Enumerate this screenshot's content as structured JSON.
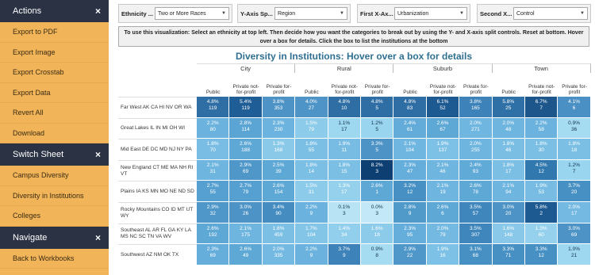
{
  "sidebar": {
    "sections": [
      {
        "title": "Actions",
        "close": "×",
        "items": [
          "Export to PDF",
          "Export Image",
          "Export Crosstab",
          "Export Data",
          "Revert All",
          "Download"
        ]
      },
      {
        "title": "Switch Sheet",
        "close": "×",
        "items": [
          "Campus Diversity",
          "Diversity in Institutions",
          "Colleges"
        ]
      },
      {
        "title": "Navigate",
        "close": "×",
        "items": [
          "Back to Workbooks"
        ]
      }
    ]
  },
  "toolbar": {
    "ethnicity": {
      "label": "Ethnicity ...",
      "value": "Two or More Races"
    },
    "yaxis": {
      "label": "Y-Axis Sp...",
      "value": "Region"
    },
    "xaxis1": {
      "label": "First X-Ax...",
      "value": "Urbanization"
    },
    "xaxis2": {
      "label": "Second X...",
      "value": "Control"
    }
  },
  "instructions": "To use this visualization: Select an ethnicity at top left.  Then decide how you want the categories to break out by using the Y- and X-axis split controls.  Reset at bottom. Hover over a box for details.  Click the box to list the institutions at the bottom",
  "title": "Diversity in Institutions: Hover over a box for details",
  "groups": [
    "City",
    "Rural",
    "Suburb",
    "Town"
  ],
  "columns": [
    "Public",
    "Private not-for-profit",
    "Private for-profit"
  ],
  "rows": [
    {
      "region": "Far West AK CA HI NV OR WA",
      "cells": [
        [
          "4.8%",
          "119"
        ],
        [
          "5.4%",
          "119"
        ],
        [
          "3.8%",
          "353"
        ],
        [
          "4.0%",
          "27"
        ],
        [
          "4.8%",
          "10"
        ],
        [
          "4.8%",
          "5"
        ],
        [
          "4.8%",
          "83"
        ],
        [
          "6.1%",
          "52"
        ],
        [
          "3.8%",
          "165"
        ],
        [
          "5.8%",
          "25"
        ],
        [
          "6.7%",
          "7"
        ],
        [
          "4.1%",
          "6"
        ]
      ]
    },
    {
      "region": "Great Lakes IL IN MI OH WI",
      "cells": [
        [
          "2.2%",
          "80"
        ],
        [
          "2.8%",
          "114"
        ],
        [
          "2.3%",
          "230"
        ],
        [
          "1.5%",
          "79"
        ],
        [
          "1.1%",
          "17"
        ],
        [
          "1.2%",
          "5"
        ],
        [
          "2.4%",
          "61"
        ],
        [
          "2.6%",
          "67"
        ],
        [
          "2.0%",
          "271"
        ],
        [
          "2.0%",
          "48"
        ],
        [
          "2.2%",
          "58"
        ],
        [
          "0.9%",
          "36"
        ]
      ]
    },
    {
      "region": "Mid East DE DC MD NJ NY PA",
      "cells": [
        [
          "1.8%",
          "70"
        ],
        [
          "2.6%",
          "188"
        ],
        [
          "1.3%",
          "168"
        ],
        [
          "1.8%",
          "55"
        ],
        [
          "1.9%",
          "11"
        ],
        [
          "3.3%",
          "5"
        ],
        [
          "2.1%",
          "104"
        ],
        [
          "1.9%",
          "137"
        ],
        [
          "2.0%",
          "255"
        ],
        [
          "1.8%",
          "46"
        ],
        [
          "1.8%",
          "30"
        ],
        [
          "1.8%",
          "18"
        ]
      ]
    },
    {
      "region": "New England CT ME MA NH RI VT",
      "cells": [
        [
          "2.1%",
          "31"
        ],
        [
          "2.9%",
          "69"
        ],
        [
          "2.5%",
          "39"
        ],
        [
          "1.8%",
          "14"
        ],
        [
          "1.8%",
          "15"
        ],
        [
          "8.2%",
          "3"
        ],
        [
          "2.3%",
          "47"
        ],
        [
          "2.1%",
          "46"
        ],
        [
          "2.4%",
          "93"
        ],
        [
          "1.8%",
          "17"
        ],
        [
          "4.5%",
          "12"
        ],
        [
          "1.2%",
          "7"
        ]
      ]
    },
    {
      "region": "Plains IA KS MN MO NE ND SD",
      "cells": [
        [
          "2.7%",
          "55"
        ],
        [
          "2.7%",
          "79"
        ],
        [
          "2.6%",
          "154"
        ],
        [
          "1.5%",
          "31"
        ],
        [
          "1.3%",
          "17"
        ],
        [
          "2.6%",
          "1"
        ],
        [
          "3.2%",
          "12"
        ],
        [
          "2.1%",
          "19"
        ],
        [
          "2.6%",
          "78"
        ],
        [
          "2.1%",
          "94"
        ],
        [
          "1.9%",
          "53"
        ],
        [
          "3.7%",
          "20"
        ]
      ]
    },
    {
      "region": "Rocky Mountains CO ID MT UT WY",
      "cells": [
        [
          "2.9%",
          "32"
        ],
        [
          "3.0%",
          "26"
        ],
        [
          "3.4%",
          "90"
        ],
        [
          "2.2%",
          "9"
        ],
        [
          "0.1%",
          "3"
        ],
        [
          "0.0%",
          "3"
        ],
        [
          "2.8%",
          "9"
        ],
        [
          "2.6%",
          "6"
        ],
        [
          "3.5%",
          "57"
        ],
        [
          "3.0%",
          "20"
        ],
        [
          "5.8%",
          "2"
        ],
        [
          "2.0%",
          "17"
        ]
      ]
    },
    {
      "region": "Southeast AL AR FL GA KY LA MS NC SC TN VA WV",
      "cells": [
        [
          "2.6%",
          "192"
        ],
        [
          "2.1%",
          "175"
        ],
        [
          "1.8%",
          "459"
        ],
        [
          "1.7%",
          "104"
        ],
        [
          "1.4%",
          "34"
        ],
        [
          "1.6%",
          "18"
        ],
        [
          "2.3%",
          "95"
        ],
        [
          "2.0%",
          "79"
        ],
        [
          "3.5%",
          "307"
        ],
        [
          "1.6%",
          "148"
        ],
        [
          "1.3%",
          "60"
        ],
        [
          "3.0%",
          "69"
        ]
      ]
    },
    {
      "region": "Southwest AZ NM OK TX",
      "cells": [
        [
          "2.3%",
          "69"
        ],
        [
          "2.6%",
          "49"
        ],
        [
          "2.0%",
          "335"
        ],
        [
          "2.2%",
          "9"
        ],
        [
          "3.7%",
          "9"
        ],
        [
          "0.9%",
          "8"
        ],
        [
          "2.9%",
          "22"
        ],
        [
          "1.9%",
          "16"
        ],
        [
          "3.1%",
          "68"
        ],
        [
          "3.3%",
          "71"
        ],
        [
          "3.3%",
          "12"
        ],
        [
          "1.0%",
          "21"
        ]
      ]
    }
  ],
  "cell_colors": [
    [
      "#2e6ea4",
      "#1f5d96",
      "#4d93c6",
      "#4e94c7",
      "#2e6ea4",
      "#2e6ea4",
      "#2e6ea4",
      "#1d5a92",
      "#3d82b9",
      "#2f71a7",
      "#1c568b",
      "#4b90c4"
    ],
    [
      "#6bb3de",
      "#5ba5d4",
      "#6cb4df",
      "#8ccbe9",
      "#9dd7f0",
      "#9ad5ef",
      "#63acda",
      "#5ea8d6",
      "#6fb6e0",
      "#6eb5df",
      "#6bb3de",
      "#a6dcf2"
    ],
    [
      "#79bde4",
      "#5ea8d6",
      "#8bc9e9",
      "#7bbfe5",
      "#78bce4",
      "#4d93c6",
      "#6fb6e0",
      "#7dc1e6",
      "#6eb5df",
      "#7abee4",
      "#7bbfe5",
      "#7bbfe5"
    ],
    [
      "#6eb5df",
      "#4f96c9",
      "#5ea8d6",
      "#7bbfe5",
      "#7bbfe5",
      "#0d3f73",
      "#65aedb",
      "#6eb5df",
      "#60aad8",
      "#7bbfe5",
      "#3178ae",
      "#9ad5ef"
    ],
    [
      "#56a0d1",
      "#56a0d1",
      "#5ea8d6",
      "#8ccbe9",
      "#95d1ed",
      "#5ea8d6",
      "#4790c3",
      "#6eb5df",
      "#5ea8d6",
      "#6eb5df",
      "#78bce4",
      "#4790c3"
    ],
    [
      "#4f96c9",
      "#4d93c6",
      "#458dc1",
      "#6bb3de",
      "#b8e3f5",
      "#c3e8f7",
      "#509aca",
      "#5ea8d6",
      "#3f86bc",
      "#4d93c6",
      "#1d5a92",
      "#74b9e2"
    ],
    [
      "#5ea8d6",
      "#6eb5df",
      "#7bbfe5",
      "#83c5e7",
      "#92cfec",
      "#8ccbe9",
      "#65aedb",
      "#74b9e2",
      "#3f86bc",
      "#89c8e8",
      "#95d1ed",
      "#4d93c6"
    ],
    [
      "#65aedb",
      "#5ea8d6",
      "#74b9e2",
      "#6bb3de",
      "#3d82b9",
      "#a6dcf2",
      "#4f96c9",
      "#7dc1e6",
      "#4790c3",
      "#4790c3",
      "#4790c3",
      "#9dd7f0"
    ]
  ]
}
